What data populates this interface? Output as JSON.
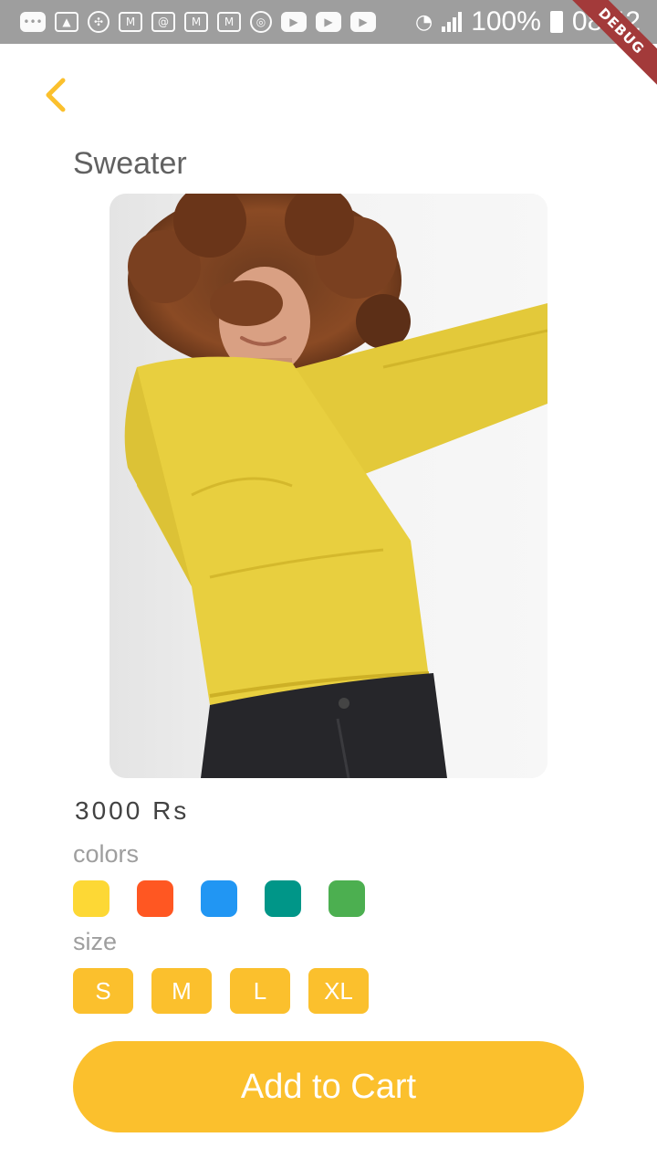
{
  "status_bar": {
    "battery": "100%",
    "time": "08:42",
    "debug_label": "DEBUG"
  },
  "product": {
    "title": "Sweater",
    "price": "3000 Rs",
    "colors_label": "colors",
    "size_label": "size"
  },
  "colors": [
    {
      "name": "yellow",
      "hex": "#fdd835"
    },
    {
      "name": "deep-orange",
      "hex": "#ff5722"
    },
    {
      "name": "blue",
      "hex": "#2196f3"
    },
    {
      "name": "teal",
      "hex": "#009688"
    },
    {
      "name": "green",
      "hex": "#4caf50"
    }
  ],
  "sizes": [
    "S",
    "M",
    "L",
    "XL"
  ],
  "actions": {
    "add_to_cart": "Add to Cart"
  },
  "theme": {
    "accent": "#fbc02d"
  }
}
